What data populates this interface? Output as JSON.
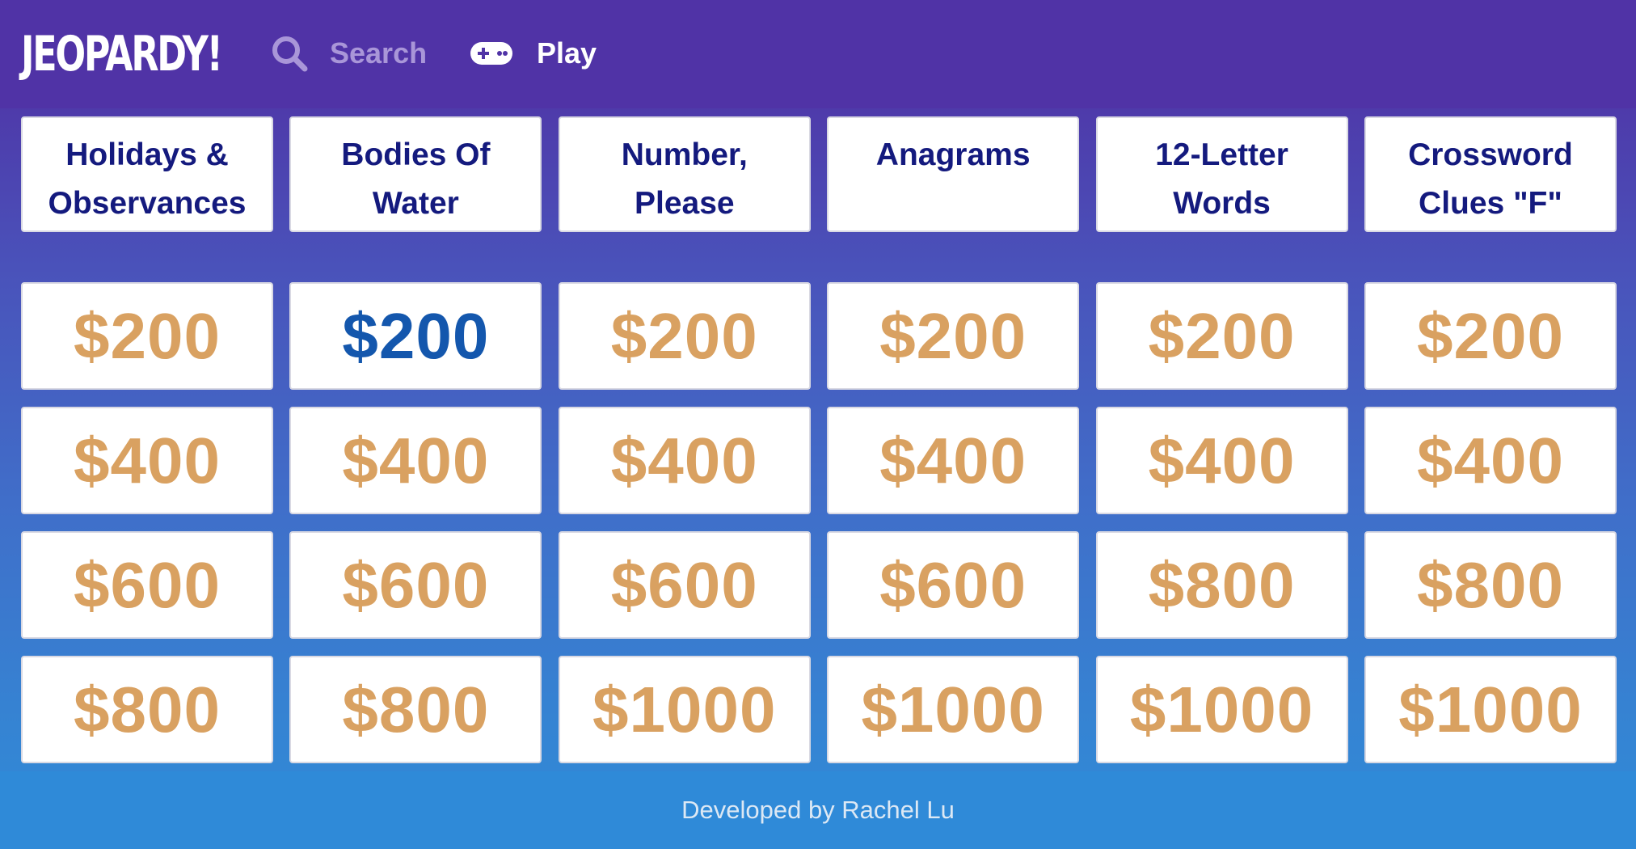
{
  "header": {
    "logo_text": "JEOPARDY!",
    "search_label": "Search",
    "play_label": "Play",
    "search_icon": "search-icon",
    "play_icon": "gamepad-icon"
  },
  "board": {
    "categories": [
      {
        "title": "Holidays & Observances"
      },
      {
        "title": "Bodies Of Water"
      },
      {
        "title": "Number, Please"
      },
      {
        "title": "Anagrams"
      },
      {
        "title": "12-Letter Words"
      },
      {
        "title": "Crossword Clues \"F\""
      }
    ],
    "rows": [
      [
        "$200",
        "$200",
        "$200",
        "$200",
        "$200",
        "$200"
      ],
      [
        "$400",
        "$400",
        "$400",
        "$400",
        "$400",
        "$400"
      ],
      [
        "$600",
        "$600",
        "$600",
        "$600",
        "$800",
        "$800"
      ],
      [
        "$800",
        "$800",
        "$1000",
        "$1000",
        "$1000",
        "$1000"
      ]
    ],
    "highlighted": {
      "row": 0,
      "col": 1
    }
  },
  "footer": {
    "text": "Developed by Rachel Lu"
  },
  "colors": {
    "header_bg": "#5033a6",
    "value_text": "#d9a161",
    "value_highlight": "#1457ad",
    "category_text": "#141a7e"
  }
}
